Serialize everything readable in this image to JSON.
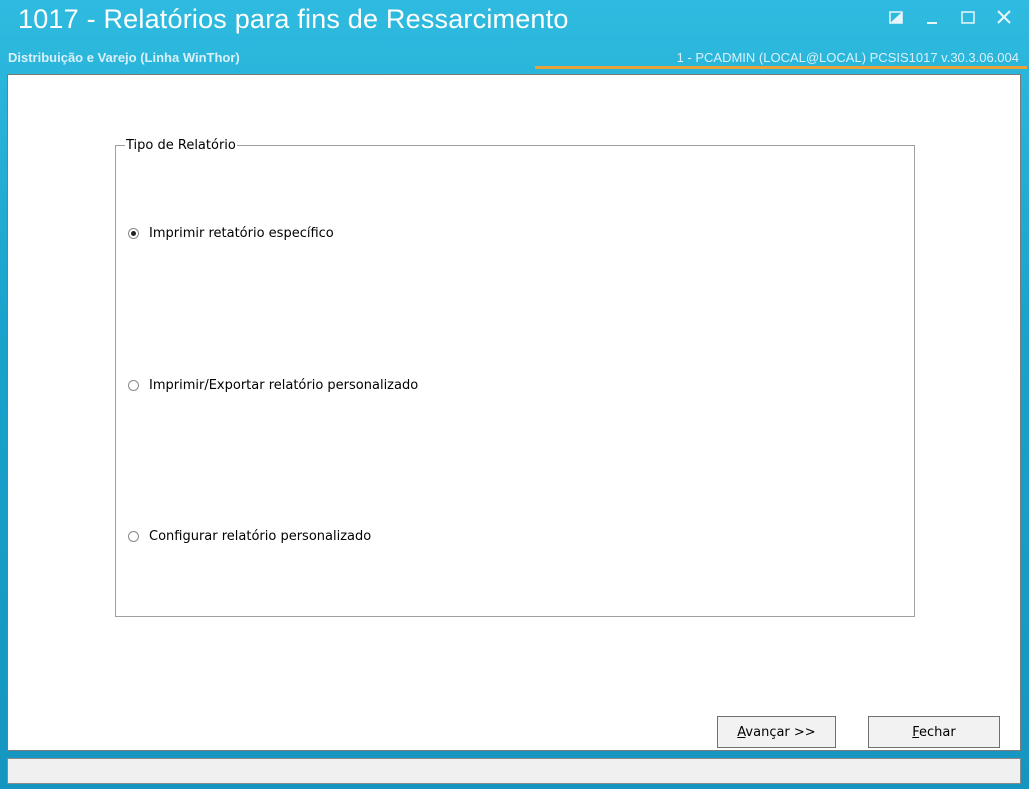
{
  "window": {
    "title": "1017 - Relatórios para fins de Ressarcimento",
    "subtitle": "Distribuição e Varejo (Linha WinThor)",
    "user_info": "1 - PCADMIN (LOCAL@LOCAL)   PCSIS1017  v.30.3.06.004",
    "accent_color": "#e8a23a",
    "frame_color": "#1aa5c9"
  },
  "group": {
    "legend": "Tipo de Relatório",
    "options": [
      {
        "label": "Imprimir retatório específico",
        "checked": true
      },
      {
        "label": "Imprimir/Exportar relatório personalizado",
        "checked": false
      },
      {
        "label": "Configurar relatório personalizado",
        "checked": false
      }
    ]
  },
  "buttons": {
    "next_prefix": "A",
    "next_rest": "vançar >>",
    "close_prefix": "F",
    "close_rest": "echar"
  },
  "status": {
    "text": ""
  }
}
